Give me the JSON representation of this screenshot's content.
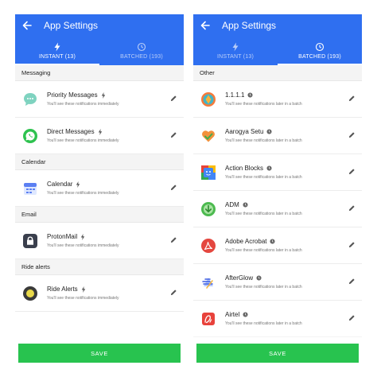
{
  "left_screen": {
    "title": "App Settings",
    "tabs": [
      {
        "label": "INSTANT (13)",
        "active": true,
        "icon": "bolt-icon"
      },
      {
        "label": "BATCHED (193)",
        "active": false,
        "icon": "clock-icon"
      }
    ],
    "sections": [
      {
        "header": "Messaging",
        "items": [
          {
            "name": "Priority Messages",
            "desc": "You'll see these notifications immediately",
            "icon": "priority-messages-icon"
          },
          {
            "name": "Direct Messages",
            "desc": "You'll see these notifications immediately",
            "icon": "whatsapp-icon"
          }
        ]
      },
      {
        "header": "Calendar",
        "items": [
          {
            "name": "Calendar",
            "desc": "You'll see these notifications immediately",
            "icon": "calendar-icon"
          }
        ]
      },
      {
        "header": "Email",
        "items": [
          {
            "name": "ProtonMail",
            "desc": "You'll see these notifications immediately",
            "icon": "protonmail-icon"
          }
        ]
      },
      {
        "header": "Ride alerts",
        "items": [
          {
            "name": "Ride Alerts",
            "desc": "You'll see these notifications immediately",
            "icon": "ride-alerts-icon"
          }
        ]
      }
    ],
    "save_label": "SAVE"
  },
  "right_screen": {
    "title": "App Settings",
    "tabs": [
      {
        "label": "INSTANT (13)",
        "active": false,
        "icon": "bolt-icon"
      },
      {
        "label": "BATCHED (193)",
        "active": true,
        "icon": "clock-icon"
      }
    ],
    "sections": [
      {
        "header": "Other",
        "items": [
          {
            "name": "1.1.1.1",
            "desc": "You'll see these notifications later in a batch",
            "icon": "cloudflare-1111-icon"
          },
          {
            "name": "Aarogya Setu",
            "desc": "You'll see these notifications later in a batch",
            "icon": "aarogya-setu-icon"
          },
          {
            "name": "Action Blocks",
            "desc": "You'll see these notifications later in a batch",
            "icon": "action-blocks-icon"
          },
          {
            "name": "ADM",
            "desc": "You'll see these notifications later in a batch",
            "icon": "adm-download-icon"
          },
          {
            "name": "Adobe Acrobat",
            "desc": "You'll see these notifications later in a batch",
            "icon": "adobe-acrobat-icon"
          },
          {
            "name": "AfterGlow",
            "desc": "You'll see these notifications later in a batch",
            "icon": "afterglow-icon"
          },
          {
            "name": "Airtel",
            "desc": "You'll see these notifications later in a batch",
            "icon": "airtel-icon"
          }
        ]
      }
    ],
    "save_label": "SAVE"
  },
  "colors": {
    "app_bar": "#2f6ff0",
    "save_button": "#28c34f",
    "section_bg": "#f4f4f4"
  }
}
